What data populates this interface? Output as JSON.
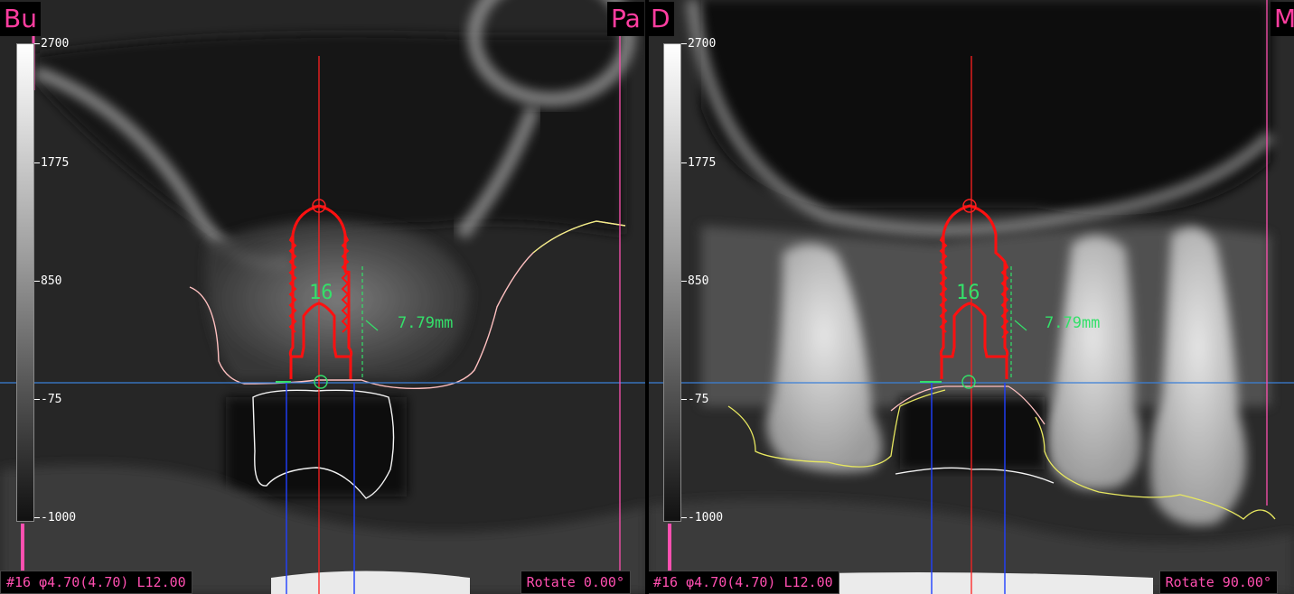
{
  "left_panel": {
    "corner_left": "Bu",
    "corner_right": "Pa",
    "scale_ticks": [
      "2700",
      "1775",
      "850",
      "-75",
      "-1000"
    ],
    "implant_number": "16",
    "measurement": "7.79mm",
    "info_implant": "#16 φ4.70(4.70) L12.00",
    "info_rotate": "Rotate  0.00°"
  },
  "right_panel": {
    "corner_left": "D",
    "corner_right": "M",
    "scale_ticks": [
      "2700",
      "1775",
      "850",
      "-75",
      "-1000"
    ],
    "implant_number": "16",
    "measurement": "7.79mm",
    "info_implant": "#16 φ4.70(4.70) L12.00",
    "info_rotate": "Rotate 90.00°"
  },
  "colors": {
    "label": "#ff3da0",
    "implant": "#ff1010",
    "axis": "#ff2020",
    "occlusal_line": "#4080ff",
    "implant_guides": "#2040ff",
    "measure": "#34e06a",
    "tissue_outline": "#ffb0b0",
    "tooth_outline": "#e8e860"
  }
}
